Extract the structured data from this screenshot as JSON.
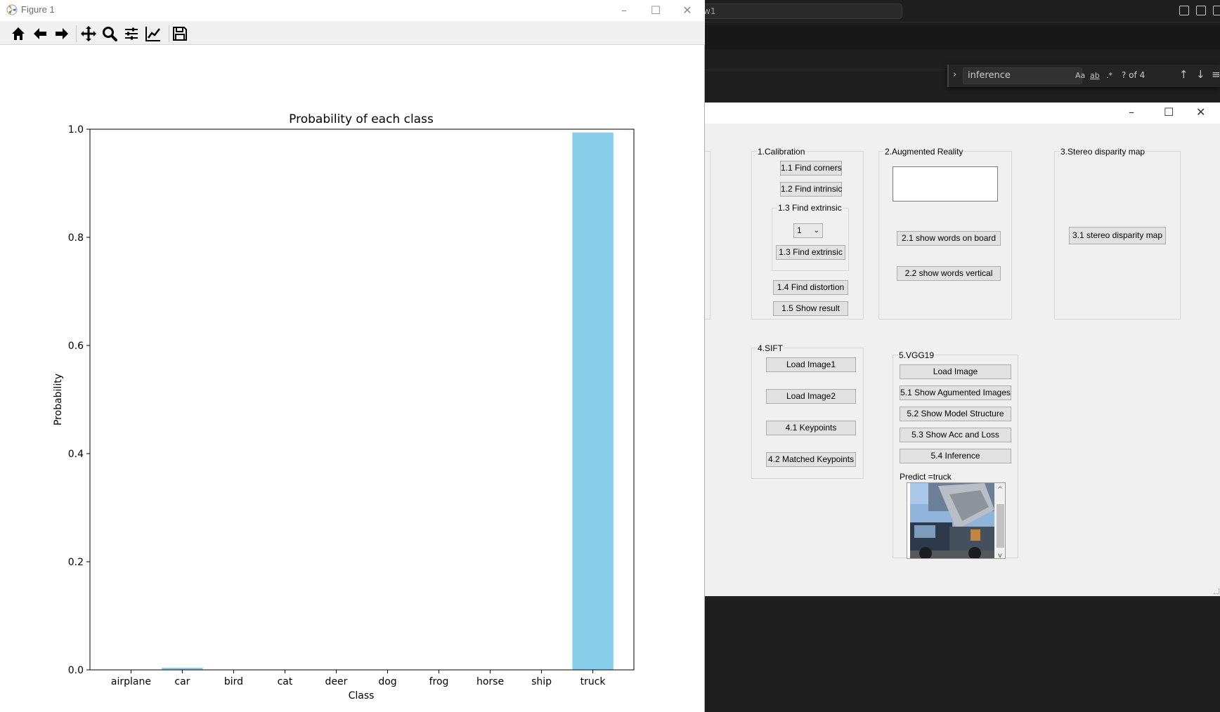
{
  "editor": {
    "command_center_text": "w1",
    "find": {
      "query": "inference",
      "match_case": "Aa",
      "whole_word": "ab",
      "regex": ".*",
      "result_count": "? of 4",
      "prev_icon": "arrow-up-icon",
      "next_icon": "arrow-down-icon"
    }
  },
  "qt_window": {
    "calibration": {
      "title": "1.Calibration",
      "find_corners": "1.1 Find corners",
      "find_intrinsic": "1.2 Find intrinsic",
      "extrinsic_group_title": "1.3 Find extrinsic",
      "extrinsic_select_value": "1",
      "find_extrinsic": "1.3 Find extrinsic",
      "find_distortion": "1.4 Find distortion",
      "show_result": "1.5 Show result"
    },
    "augmented_reality": {
      "title": "2.Augmented Reality",
      "text_input_value": "",
      "show_words_on_board": "2.1 show words on board",
      "show_words_vertical": "2.2 show words vertical"
    },
    "stereo": {
      "title": "3.Stereo disparity map",
      "stereo_disparity_map": "3.1 stereo disparity map"
    },
    "sift": {
      "title": "4.SIFT",
      "load_image1": "Load Image1",
      "load_image2": "Load Image2",
      "keypoints": "4.1 Keypoints",
      "matched_keypoints": "4.2 Matched Keypoints"
    },
    "vgg19": {
      "title": "5.VGG19",
      "load_image": "Load Image",
      "show_augmented_images": "5.1 Show Agumented Images",
      "show_model_structure": "5.2 Show Model Structure",
      "show_acc_and_loss": "5.3 Show Acc and Loss",
      "inference": "5.4 Inference",
      "predict_label": "Predict =truck"
    }
  },
  "figure_window": {
    "title": "Figure 1",
    "toolbar_icons": [
      "home-icon",
      "back-arrow-icon",
      "forward-arrow-icon",
      "pan-icon",
      "zoom-icon",
      "configure-subplots-icon",
      "edit-axis-icon",
      "save-icon"
    ],
    "colors": {
      "bar": "#87ceeb",
      "axes": "#000000"
    }
  },
  "chart_data": {
    "type": "bar",
    "title": "Probability of each class",
    "xlabel": "Class",
    "ylabel": "Probability",
    "categories": [
      "airplane",
      "car",
      "bird",
      "cat",
      "deer",
      "dog",
      "frog",
      "horse",
      "ship",
      "truck"
    ],
    "values": [
      0.0,
      0.004,
      0.0,
      0.0,
      0.0,
      0.0,
      0.0,
      0.0,
      0.0,
      0.994
    ],
    "ylim": [
      0,
      1.0
    ],
    "yticks": [
      "0.0",
      "0.2",
      "0.4",
      "0.6",
      "0.8",
      "1.0"
    ],
    "grid": false,
    "legend": "none"
  }
}
